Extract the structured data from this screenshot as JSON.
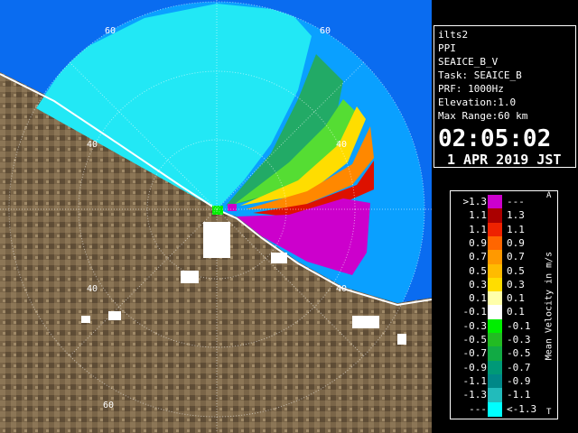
{
  "info": {
    "lines": [
      "ilts2",
      "PPI",
      "SEAICE_B_V",
      "Task: SEAICE_B",
      "PRF: 1000Hz",
      "Elevation:1.0",
      "Max Range:60 km"
    ],
    "time": "02:05:02",
    "date": "1 APR 2019 JST"
  },
  "range_labels": [
    "60",
    "60",
    "40",
    "40",
    "40",
    "40",
    "60"
  ],
  "legend": {
    "title": "Mean Velocity in m/s",
    "top_marker": "A",
    "bottom_marker": "T",
    "rows": [
      {
        "left": ">1.3",
        "right": "---",
        "color": "#cc00cc"
      },
      {
        "left": "1.1",
        "right": "1.3",
        "color": "#aa0000"
      },
      {
        "left": "1.1",
        "right": "1.1",
        "color": "#ee2200"
      },
      {
        "left": "0.9",
        "right": "0.9",
        "color": "#ff6600"
      },
      {
        "left": "0.7",
        "right": "0.7",
        "color": "#ff9900"
      },
      {
        "left": "0.5",
        "right": "0.5",
        "color": "#ffbb00"
      },
      {
        "left": "0.3",
        "right": "0.3",
        "color": "#ffdd00"
      },
      {
        "left": "0.1",
        "right": "0.1",
        "color": "#ffffaa"
      },
      {
        "left": "-0.1",
        "right": "0.1",
        "color": "#ffffff"
      },
      {
        "left": "-0.3",
        "right": "-0.1",
        "color": "#00ee00"
      },
      {
        "left": "-0.5",
        "right": "-0.3",
        "color": "#22bb22"
      },
      {
        "left": "-0.7",
        "right": "-0.5",
        "color": "#11aa44"
      },
      {
        "left": "-0.9",
        "right": "-0.7",
        "color": "#009977"
      },
      {
        "left": "-1.1",
        "right": "-0.9",
        "color": "#008888"
      },
      {
        "left": "-1.3",
        "right": "-1.1",
        "color": "#22bbbb"
      },
      {
        "left": "---",
        "right": "<-1.3",
        "color": "#00ffff"
      }
    ]
  },
  "colors": {
    "sea": "#0a6cf0",
    "land": "#7a6548",
    "outer_sea": "#1080ff"
  }
}
